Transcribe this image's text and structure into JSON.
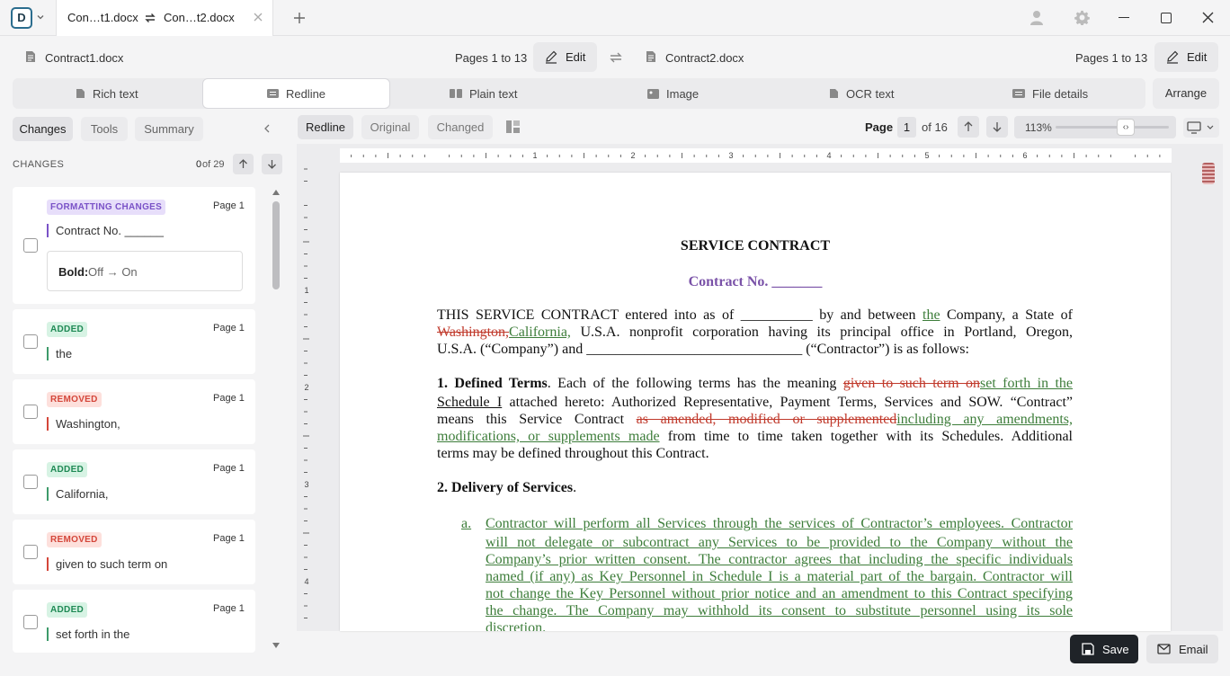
{
  "titlebar": {
    "app_letter": "D",
    "tab_left_name": "Con…t1.docx",
    "tab_right_name": "Con…t2.docx"
  },
  "filebar": {
    "left_file": "Contract1.docx",
    "left_pages": "Pages 1 to 13",
    "edit_label": "Edit",
    "right_file": "Contract2.docx",
    "right_pages": "Pages 1 to 13"
  },
  "view_tabs": [
    "Rich text",
    "Redline",
    "Plain text",
    "Image",
    "OCR text",
    "File details"
  ],
  "arrange_label": "Arrange",
  "sidebar": {
    "tabs": [
      "Changes",
      "Tools",
      "Summary"
    ],
    "heading": "CHANGES",
    "counter_current": "0",
    "counter_total": "of 29",
    "changes": [
      {
        "badge": "FORMATTING CHANGES",
        "type": "fmt",
        "page": "Page 1",
        "text": "Contract No. ______",
        "detail_key": "Bold:",
        "detail_val": "Off → On"
      },
      {
        "badge": "ADDED",
        "type": "add",
        "page": "Page 1",
        "text": "the"
      },
      {
        "badge": "REMOVED",
        "type": "rem",
        "page": "Page 1",
        "text": "Washington,"
      },
      {
        "badge": "ADDED",
        "type": "add",
        "page": "Page 1",
        "text": "California,"
      },
      {
        "badge": "REMOVED",
        "type": "rem",
        "page": "Page 1",
        "text": "given to such term on"
      },
      {
        "badge": "ADDED",
        "type": "add",
        "page": "Page 1",
        "text": "set forth in the"
      }
    ]
  },
  "doc_toolbar": {
    "modes": [
      "Redline",
      "Original",
      "Changed"
    ],
    "page_label": "Page",
    "page_num": "1",
    "page_total": "of 16",
    "zoom": "113%",
    "zoom_level": 0.62
  },
  "ruler_numbers": [
    "1",
    "2",
    "3",
    "4",
    "5",
    "6"
  ],
  "vruler_numbers": [
    "1",
    "2",
    "3",
    "4"
  ],
  "document": {
    "title": "SERVICE CONTRACT",
    "contract_no": "Contract No. _______",
    "p1_l1a": "THIS SERVICE CONTRACT entered into as of __________ by and between ",
    "p1_l1_ins": "the",
    "p1_l1b": " Company, a State of",
    "p1_l2_del": "Washington,",
    "p1_l2_ins": "California,",
    "p1_l2b": " U.S.A. nonprofit corporation having its principal office in Portland, Oregon,",
    "p1_l3": "U.S.A. (“Company”) and ______________________________ (“Contractor”) is as follows:",
    "s1_num": "1.",
    "s1_head": "Defined Terms",
    "s1_l1a": ". Each of the following terms has the meaning ",
    "s1_l1_del": "given to such term on",
    "s1_l1_ins": "set forth in the",
    "s1_l2_ins": "Schedule I",
    "s1_l2b": " attached hereto: Authorized Representative, Payment Terms, Services and SOW. “Contract”",
    "s1_l3a": "means this Service Contract ",
    "s1_l3_del": "as amended, modified or supplemented",
    "s1_l3_ins": "including any amendments,",
    "s1_l4_ins": "modifications, or supplements made",
    "s1_l4b": " from time to time taken together with its Schedules. Additional",
    "s1_l5": "terms may be defined throughout this Contract.",
    "s2_num": "2.",
    "s2_head": "Delivery of Services",
    "s2_dot": ".",
    "a_label": "a.",
    "a_lines": [
      "Contractor will perform all Services through the services of Contractor’s employees. Contractor",
      "will not delegate or subcontract any Services to be provided to the Company without the",
      "Company’s prior written consent. The contractor agrees that including the specific individuals",
      "named (if any) as Key Personnel in Schedule I is a material part of the bargain. Contractor will",
      "not change the Key Personnel without prior notice and an amendment to this Contract specifying",
      "the change. The Company may withhold its consent to substitute personnel using its sole",
      "discretion."
    ]
  },
  "footer": {
    "save_label": "Save",
    "email_label": "Email"
  },
  "colors": {
    "added": "#3d7d3a",
    "removed": "#c0392b",
    "formatting": "#7a52c7",
    "save_bg": "#1f2328"
  }
}
